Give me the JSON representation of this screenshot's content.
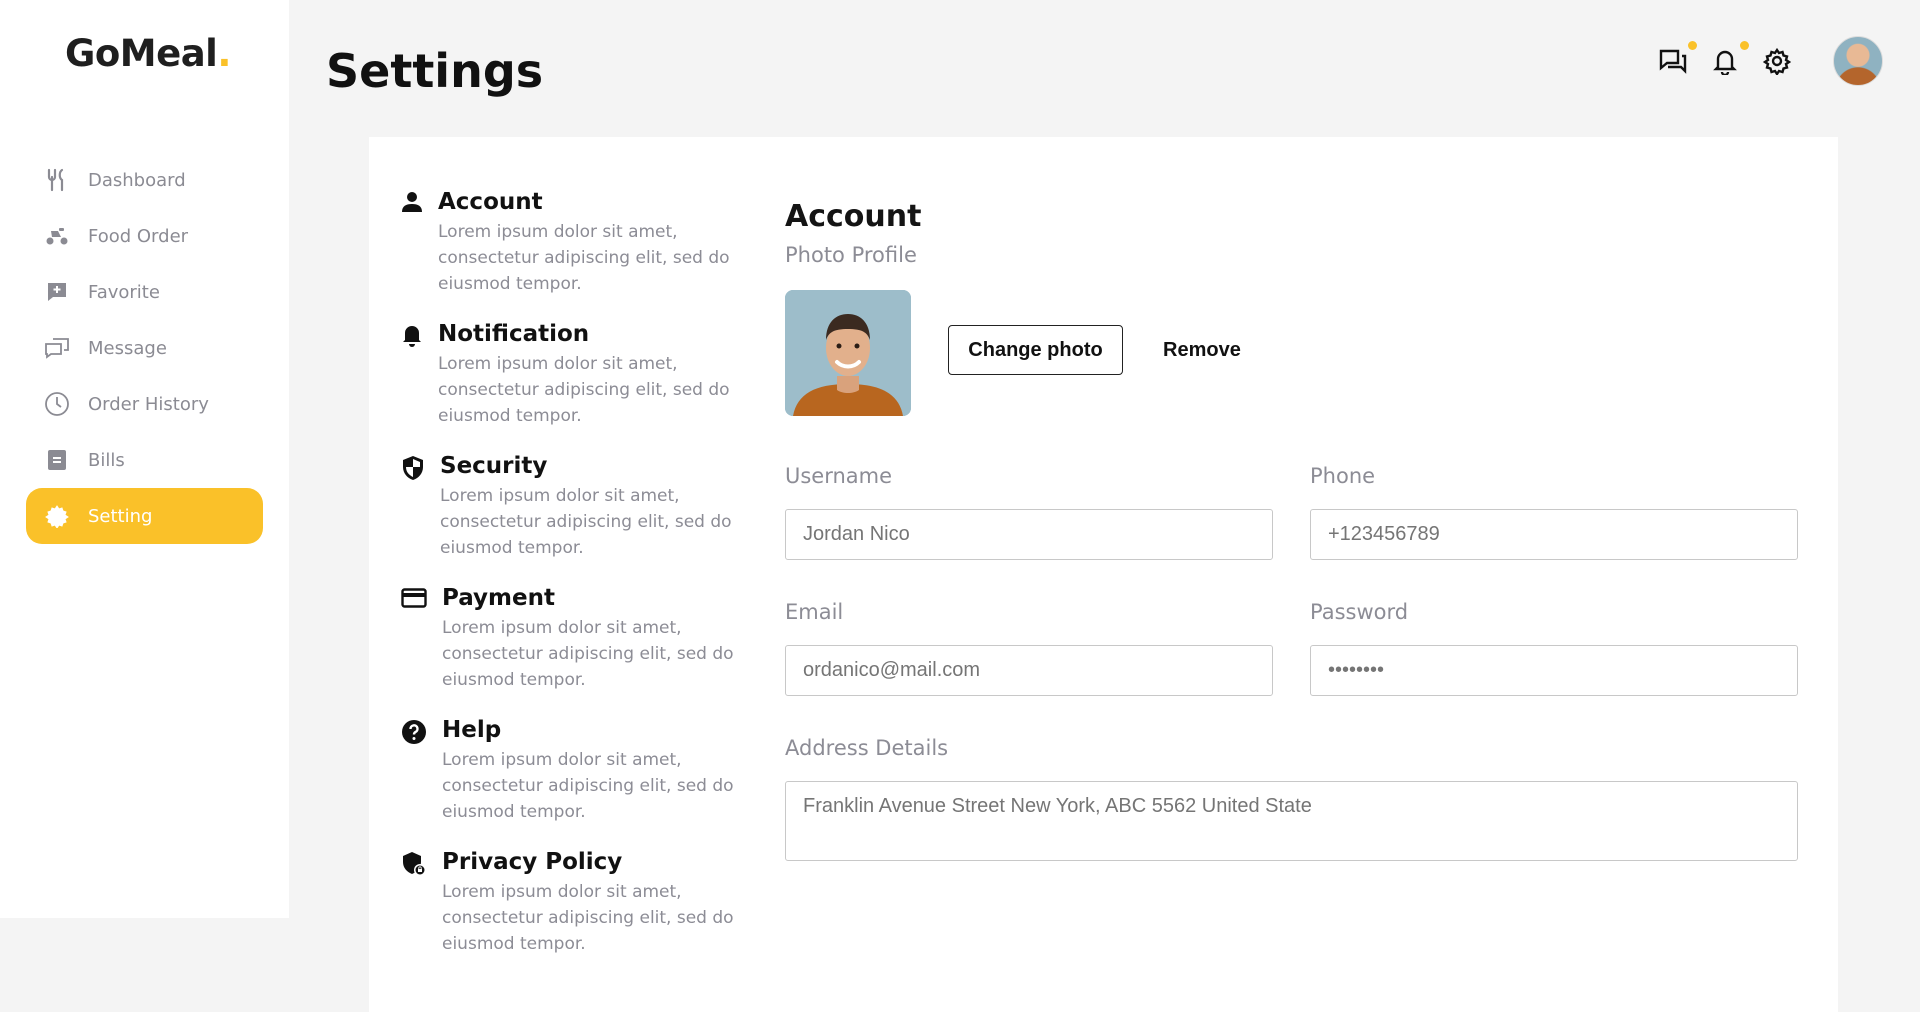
{
  "brand": {
    "name": "GoMeal",
    "dot": "."
  },
  "page": {
    "title": "Settings"
  },
  "sidebar": {
    "items": [
      {
        "label": "Dashboard",
        "icon": "fork-knife-icon"
      },
      {
        "label": "Food Order",
        "icon": "scooter-icon"
      },
      {
        "label": "Favorite",
        "icon": "favorite-chat-icon"
      },
      {
        "label": "Message",
        "icon": "message-icon"
      },
      {
        "label": "Order History",
        "icon": "clock-icon"
      },
      {
        "label": "Bills",
        "icon": "bill-icon"
      },
      {
        "label": "Setting",
        "icon": "gear-icon",
        "active": true
      }
    ]
  },
  "topbar": {
    "icons": [
      "chat-icon",
      "bell-icon",
      "gear-icon",
      "avatar"
    ],
    "accent": "#fac129"
  },
  "menu": {
    "items": [
      {
        "title": "Account",
        "desc": "Lorem ipsum dolor sit amet, consectetur adipiscing elit, sed do eiusmod tempor.",
        "icon": "person-icon"
      },
      {
        "title": "Notification",
        "desc": "Lorem ipsum dolor sit amet, consectetur adipiscing elit, sed do eiusmod tempor.",
        "icon": "bell-icon"
      },
      {
        "title": "Security",
        "desc": "Lorem ipsum dolor sit amet, consectetur adipiscing elit, sed do eiusmod tempor.",
        "icon": "shield-icon"
      },
      {
        "title": "Payment",
        "desc": "Lorem ipsum dolor sit amet, consectetur adipiscing elit, sed do eiusmod tempor.",
        "icon": "credit-card-icon"
      },
      {
        "title": "Help",
        "desc": "Lorem ipsum dolor sit amet, consectetur adipiscing elit, sed do eiusmod tempor.",
        "icon": "help-icon"
      },
      {
        "title": "Privacy Policy",
        "desc": "Lorem ipsum dolor sit amet, consectetur adipiscing elit, sed do eiusmod tempor.",
        "icon": "privacy-shield-icon"
      }
    ]
  },
  "account": {
    "title": "Account",
    "photo_label": "Photo Profile",
    "change_photo": "Change photo",
    "remove": "Remove",
    "username_label": "Username",
    "username_value": "Jordan Nico",
    "phone_label": "Phone",
    "phone_value": "+123456789",
    "email_label": "Email",
    "email_value": "ordanico@mail.com",
    "password_label": "Password",
    "password_value": "••••••••",
    "address_label": "Address Details",
    "address_value": "Franklin Avenue Street New York, ABC 5562 United State"
  }
}
